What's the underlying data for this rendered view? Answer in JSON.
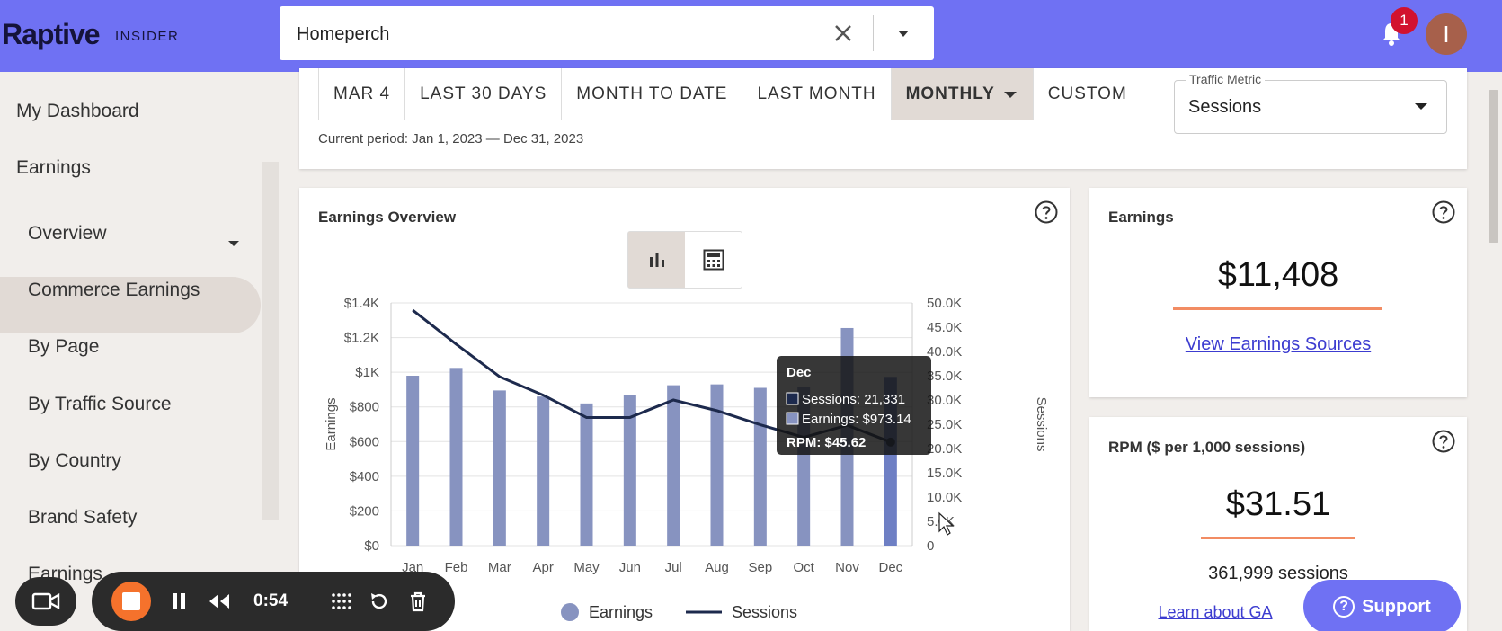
{
  "header": {
    "logo": "Raptive",
    "logo_sub": "INSIDER",
    "site_select_value": "Homeperch",
    "notification_count": "1",
    "avatar_initial": "I"
  },
  "sidebar": {
    "items": [
      {
        "label": "My Dashboard"
      },
      {
        "label": "Earnings"
      },
      {
        "label": "Overview"
      },
      {
        "label": "Commerce Earnings"
      },
      {
        "label": "By Page"
      },
      {
        "label": "By Traffic Source"
      },
      {
        "label": "By Country"
      },
      {
        "label": "Brand Safety"
      },
      {
        "label": "Earnings"
      }
    ]
  },
  "range": {
    "buttons": [
      "MAR 4",
      "LAST 30 DAYS",
      "MONTH TO DATE",
      "LAST MONTH",
      "MONTHLY",
      "CUSTOM"
    ],
    "active": "MONTHLY",
    "period": "Current period: Jan 1, 2023 — Dec 31, 2023",
    "metric_label": "Traffic Metric",
    "metric_value": "Sessions"
  },
  "overview": {
    "title": "Earnings Overview"
  },
  "chart_data": {
    "type": "bar",
    "categories": [
      "Jan",
      "Feb",
      "Mar",
      "Apr",
      "May",
      "Jun",
      "Jul",
      "Aug",
      "Sep",
      "Oct",
      "Nov",
      "Dec"
    ],
    "series": [
      {
        "name": "Earnings",
        "type": "bar",
        "axis": "left",
        "color": "#8793c0",
        "values": [
          980,
          1025,
          895,
          860,
          820,
          870,
          925,
          930,
          910,
          915,
          1255,
          973.14
        ]
      },
      {
        "name": "Sessions",
        "type": "line",
        "axis": "right",
        "color": "#1d2a4d",
        "values": [
          48500,
          41500,
          34800,
          31000,
          26400,
          26400,
          30000,
          27800,
          24900,
          22300,
          24800,
          21331
        ]
      }
    ],
    "ylabel": "Earnings",
    "y2label": "Sessions",
    "yticks": [
      "$0",
      "$200",
      "$400",
      "$600",
      "$800",
      "$1K",
      "$1.2K",
      "$1.4K"
    ],
    "y2ticks": [
      "0",
      "5.0K",
      "10.0K",
      "15.0K",
      "20.0K",
      "25.0K",
      "30.0K",
      "35.0K",
      "40.0K",
      "45.0K",
      "50.0K"
    ],
    "ylim": [
      0,
      1400
    ],
    "y2lim": [
      0,
      50000
    ],
    "legend": [
      "Earnings",
      "Sessions"
    ],
    "tooltip": {
      "title": "Dec",
      "sessions": "Sessions: 21,331",
      "earnings": "Earnings: $973.14",
      "rpm": "RPM: $45.62"
    }
  },
  "earnings_card": {
    "title": "Earnings",
    "value": "$11,408",
    "link": "View Earnings Sources"
  },
  "rpm_card": {
    "title": "RPM ($ per 1,000 sessions)",
    "value": "$31.51",
    "sessions": "361,999 sessions",
    "link": "Learn about GA"
  },
  "support": {
    "label": "Support"
  },
  "recorder": {
    "time": "0:54"
  },
  "colors": {
    "brand": "#6f71f3",
    "accent": "#f28c63",
    "bar": "#8793c0",
    "line": "#1d2a4d"
  }
}
